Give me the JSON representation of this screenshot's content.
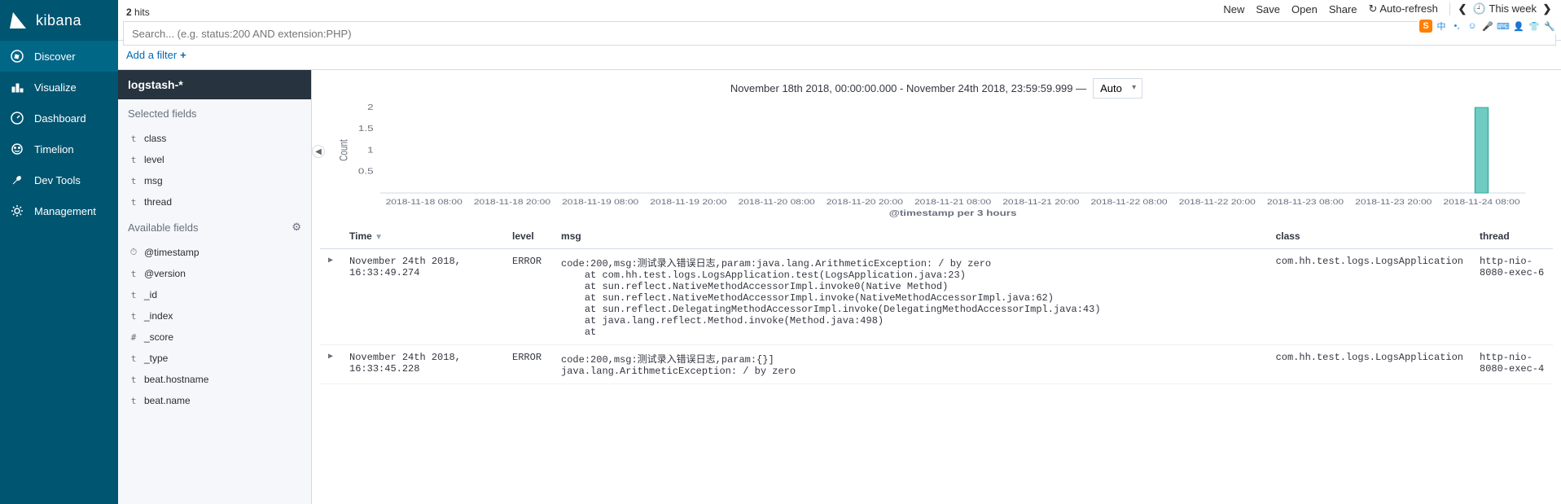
{
  "brand": "kibana",
  "nav": {
    "items": [
      {
        "label": "Discover",
        "icon": "compass"
      },
      {
        "label": "Visualize",
        "icon": "bar"
      },
      {
        "label": "Dashboard",
        "icon": "gauge"
      },
      {
        "label": "Timelion",
        "icon": "face"
      },
      {
        "label": "Dev Tools",
        "icon": "wrench"
      },
      {
        "label": "Management",
        "icon": "gear"
      }
    ]
  },
  "hits": {
    "count": "2",
    "label": "hits"
  },
  "search": {
    "placeholder": "Search... (e.g. status:200 AND extension:PHP)"
  },
  "top_actions": {
    "new": "New",
    "save": "Save",
    "open": "Open",
    "share": "Share",
    "autorefresh": "Auto-refresh",
    "timerange": "This week"
  },
  "filter": {
    "add": "Add a filter",
    "plus": "+"
  },
  "index_pattern": "logstash-*",
  "fields": {
    "selected_label": "Selected fields",
    "available_label": "Available fields",
    "selected": [
      {
        "type": "t",
        "name": "class"
      },
      {
        "type": "t",
        "name": "level"
      },
      {
        "type": "t",
        "name": "msg"
      },
      {
        "type": "t",
        "name": "thread"
      }
    ],
    "available": [
      {
        "type": "⏱",
        "name": "@timestamp"
      },
      {
        "type": "t",
        "name": "@version"
      },
      {
        "type": "t",
        "name": "_id"
      },
      {
        "type": "t",
        "name": "_index"
      },
      {
        "type": "#",
        "name": "_score"
      },
      {
        "type": "t",
        "name": "_type"
      },
      {
        "type": "t",
        "name": "beat.hostname"
      },
      {
        "type": "t",
        "name": "beat.name"
      }
    ]
  },
  "time_header": {
    "range": "November 18th 2018, 00:00:00.000 - November 24th 2018, 23:59:59.999 —",
    "interval": "Auto"
  },
  "table": {
    "cols": {
      "time": "Time",
      "level": "level",
      "msg": "msg",
      "class": "class",
      "thread": "thread"
    },
    "rows": [
      {
        "time": "November 24th 2018, 16:33:49.274",
        "level": "ERROR",
        "msg": "code:200,msg:测试录入错误日志,param:java.lang.ArithmeticException: / by zero\n    at com.hh.test.logs.LogsApplication.test(LogsApplication.java:23)\n    at sun.reflect.NativeMethodAccessorImpl.invoke0(Native Method)\n    at sun.reflect.NativeMethodAccessorImpl.invoke(NativeMethodAccessorImpl.java:62)\n    at sun.reflect.DelegatingMethodAccessorImpl.invoke(DelegatingMethodAccessorImpl.java:43)\n    at java.lang.reflect.Method.invoke(Method.java:498)\n    at",
        "class": "com.hh.test.logs.LogsApplication",
        "thread": "http-nio-8080-exec-6"
      },
      {
        "time": "November 24th 2018, 16:33:45.228",
        "level": "ERROR",
        "msg": "code:200,msg:测试录入错误日志,param:{}]\njava.lang.ArithmeticException: / by zero",
        "class": "com.hh.test.logs.LogsApplication",
        "thread": "http-nio-8080-exec-4"
      }
    ]
  },
  "chart_data": {
    "type": "bar",
    "title": "",
    "xlabel": "@timestamp per 3 hours",
    "ylabel": "Count",
    "ylim": [
      0,
      2
    ],
    "yticks": [
      0.5,
      1,
      1.5,
      2
    ],
    "categories": [
      "2018-11-18 08:00",
      "2018-11-18 20:00",
      "2018-11-19 08:00",
      "2018-11-19 20:00",
      "2018-11-20 08:00",
      "2018-11-20 20:00",
      "2018-11-21 08:00",
      "2018-11-21 20:00",
      "2018-11-22 08:00",
      "2018-11-22 20:00",
      "2018-11-23 08:00",
      "2018-11-23 20:00",
      "2018-11-24 08:00"
    ],
    "values": [
      0,
      0,
      0,
      0,
      0,
      0,
      0,
      0,
      0,
      0,
      0,
      0,
      2
    ],
    "bar_color": "#6FCCC2"
  }
}
